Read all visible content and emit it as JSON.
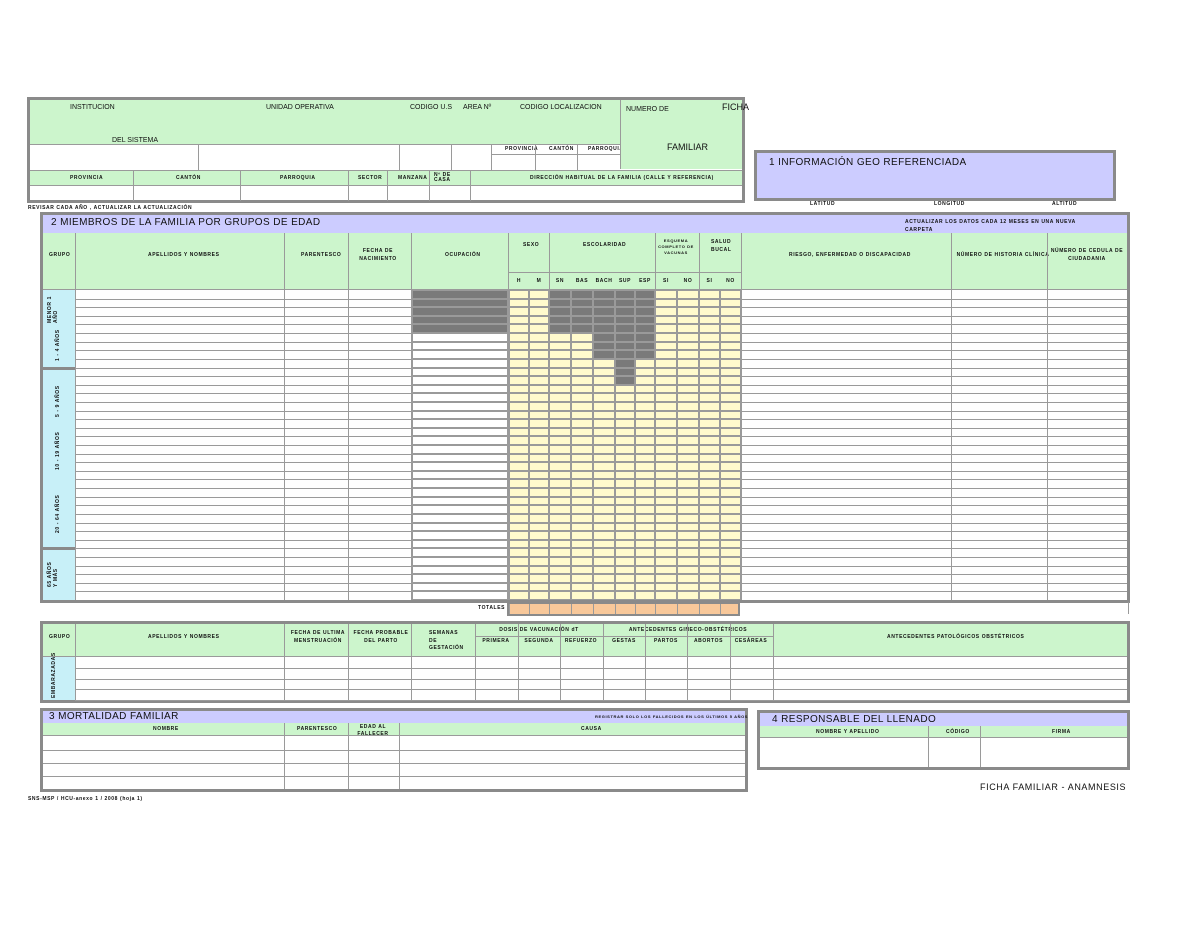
{
  "header": {
    "institucion": "INSTITUCION",
    "del_sistema": "DEL  SISTEMA",
    "unidad_operativa": "UNIDAD OPERATIVA",
    "codigo_us": "CODIGO U.S",
    "area_label": "AREA Nº",
    "codigo_localizacion": "CODIGO LOCALIZACION",
    "sub_1": "PROVINCIA",
    "sub_2": "CANTÓN",
    "sub_3": "PARROQUIA",
    "numero_de": "NUMERO DE",
    "ficha": "FICHA",
    "familiar": "FAMILIAR",
    "provincia": "PROVINCIA",
    "canton": "CANTÓN",
    "parroquia": "PARROQUIA",
    "sector": "SECTOR",
    "manzana": "MANZANA",
    "num_casa": "Nº DE CASA",
    "direccion": "DIRECCIÓN HABITUAL DE LA FAMILIA (CALLE Y REFERENCIA)",
    "note": "REVISAR CADA AÑO , ACTUALIZAR LA ACTUALIZACIÓN"
  },
  "geo": {
    "title": "1    INFORMACIÓN GEO REFERENCIADA",
    "latitud": "LATITUD",
    "longitud": "LONGITUD",
    "altitud": "ALTITUD"
  },
  "members": {
    "title": "2   MIEMBROS DE LA FAMILIA POR GRUPOS DE EDAD",
    "update_note": "ACTUALIZAR LOS DATOS CADA 12 MESES EN UNA NUEVA CARPETA",
    "col_grupo": "GRUPO",
    "col_apellidos": "APELLIDOS Y NOMBRES",
    "col_parentesco": "PARENTESCO",
    "col_fecha_nac": "FECHA DE NACIMIENTO",
    "col_ocupacion": "OCUPACIÓN",
    "col_sexo": "SEXO",
    "col_escolaridad": "ESCOLARIDAD",
    "col_esquema": "ESQUEMA COMPLETO DE VACUNAS",
    "col_salud_bucal": "SALUD BUCAL",
    "col_riesgo": "RIESGO, ENFERMEDAD O DISCAPACIDAD",
    "col_historia": "NÚMERO DE HISTORIA CLÍNICA",
    "col_cedula": "NÚMERO DE CEDULA DE CIUDADANIA",
    "sub_h": "H",
    "sub_m": "M",
    "sub_sn": "SN",
    "sub_bas": "BAS",
    "sub_bach": "BACH",
    "sub_sup": "SUP",
    "sub_esp": "ESP",
    "sub_si": "SI",
    "sub_no": "NO",
    "sub_si2": "SI",
    "sub_no2": "NO",
    "groups": [
      "MENOR 1 AÑO",
      "1 - 4 AÑOS",
      "5 - 9 AÑOS",
      "10 - 19 AÑOS",
      "20 - 64 AÑOS",
      "65 AÑOS Y MÁS"
    ],
    "totales": "TOTALES"
  },
  "pregnant": {
    "col_grupo": "GRUPO",
    "col_apellidos": "APELLIDOS Y NOMBRES",
    "col_fum": "FECHA DE ULTIMA MENSTRUACIÓN",
    "col_fpp": "FECHA PROBABLE DEL PARTO",
    "col_semanas": "SEMANAS DE GESTACIÓN",
    "col_dosis": "DOSIS DE VACUNACIÓN dT",
    "col_primera": "PRIMERA",
    "col_segunda": "SEGUNDA",
    "col_refuerzo": "REFUERZO",
    "col_antecedentes": "ANTECEDENTES GINECO-OBSTÉTRICOS",
    "col_gestas": "GESTAS",
    "col_partos": "PARTOS",
    "col_abortos": "ABORTOS",
    "col_cesareas": "CESÁREAS",
    "col_patologicos": "ANTECEDENTES PATOLÓGICOS OBSTÉTRICOS",
    "group": "EMBARAZADAS"
  },
  "mortality": {
    "title": "3   MORTALIDAD FAMILIAR",
    "note": "REGISTRAR SOLO LOS FALLECIDOS EN LOS ÚLTIMOS 5 AÑOS",
    "col_nombre": "NOMBRE",
    "col_parentesco": "PARENTESCO",
    "col_edad": "EDAD AL FALLECER",
    "col_causa": "CAUSA"
  },
  "responsible": {
    "title": "4   RESPONSABLE DEL LLENADO",
    "col_nombre": "NOMBRE Y APELLIDO",
    "col_codigo": "CÓDIGO",
    "col_firma": "FIRMA"
  },
  "footer": {
    "doc_title": "FICHA FAMILIAR - ANAMNESIS",
    "form_code": "SNS-MSP / HCU-anexo 1 / 2008 (hoja 1)"
  }
}
